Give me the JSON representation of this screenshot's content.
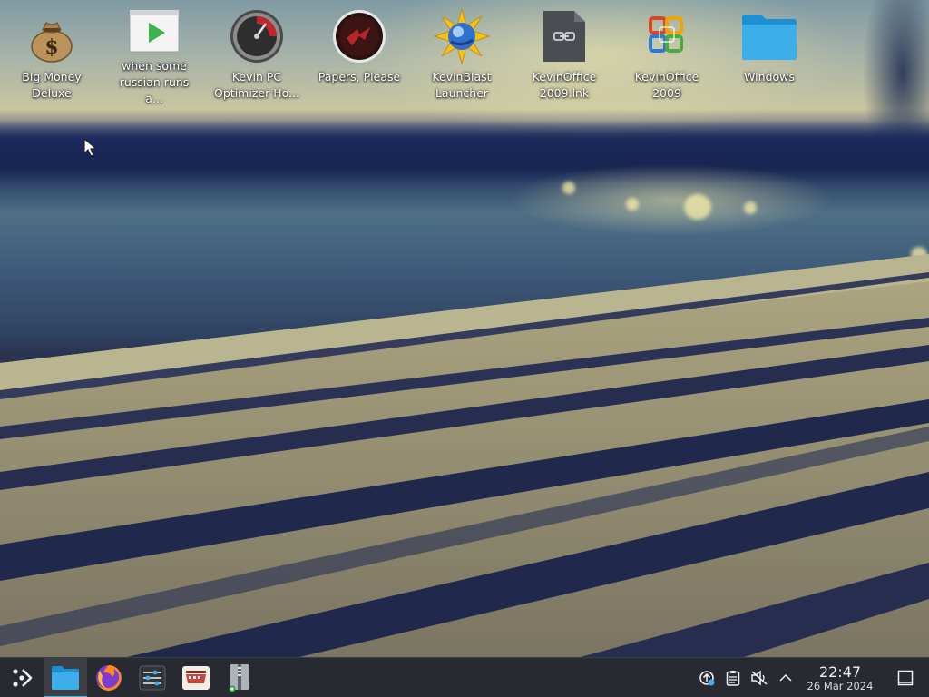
{
  "desktop": {
    "icons": [
      {
        "label": "Big Money Deluxe",
        "icon": "money-bag-icon"
      },
      {
        "label": "when some russian runs a...",
        "icon": "video-play-icon"
      },
      {
        "label": "Kevin PC Optimizer Ho...",
        "icon": "speedometer-icon"
      },
      {
        "label": "Papers, Please",
        "icon": "papers-please-icon"
      },
      {
        "label": "KevinBlast Launcher",
        "icon": "kevinblast-icon"
      },
      {
        "label": "KevinOffice 2009.lnk",
        "icon": "shortcut-file-icon"
      },
      {
        "label": "KevinOffice 2009",
        "icon": "office-logo-icon"
      },
      {
        "label": "Windows",
        "icon": "folder-icon"
      }
    ]
  },
  "taskbar": {
    "launcher_icon": "app-launcher-icon",
    "pinned": [
      {
        "icon": "file-manager-icon",
        "active": true
      },
      {
        "icon": "firefox-icon",
        "active": false
      },
      {
        "icon": "system-settings-icon",
        "active": false
      },
      {
        "icon": "app-store-icon",
        "active": false
      },
      {
        "icon": "archive-manager-icon",
        "active": false
      }
    ],
    "tray": [
      {
        "icon": "update-notifier-icon"
      },
      {
        "icon": "clipboard-icon"
      },
      {
        "icon": "volume-muted-icon"
      },
      {
        "icon": "tray-expand-icon"
      }
    ],
    "clock": {
      "time": "22:47",
      "date": "26 Mar 2024"
    },
    "show_desktop_icon": "show-desktop-icon"
  },
  "colors": {
    "accent": "#3daee9",
    "taskbar_bg": "#272a30",
    "label_text": "#ffffff"
  }
}
